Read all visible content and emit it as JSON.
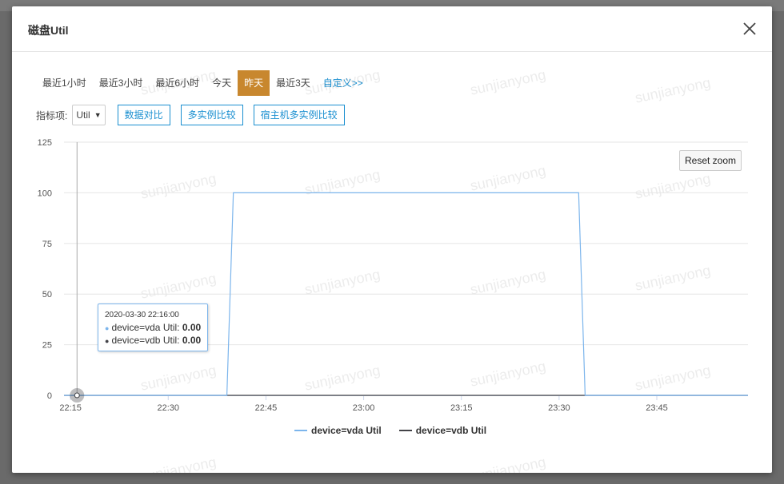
{
  "modal": {
    "title": "磁盘Util"
  },
  "time_ranges": [
    {
      "label": "最近1小时",
      "active": false
    },
    {
      "label": "最近3小时",
      "active": false
    },
    {
      "label": "最近6小时",
      "active": false
    },
    {
      "label": "今天",
      "active": false
    },
    {
      "label": "昨天",
      "active": true
    },
    {
      "label": "最近3天",
      "active": false
    }
  ],
  "custom_range_label": "自定义>>",
  "metric": {
    "label": "指标项:",
    "selected": "Util",
    "buttons": [
      "数据对比",
      "多实例比较",
      "宿主机多实例比较"
    ]
  },
  "reset_zoom_label": "Reset zoom",
  "watermark_text": "sunjianyong",
  "tooltip": {
    "time": "2020-03-30 22:16:00",
    "rows": [
      {
        "name": "device=vda Util",
        "value": "0.00",
        "color": "#7cb5ec"
      },
      {
        "name": "device=vdb Util",
        "value": "0.00",
        "color": "#434348"
      }
    ]
  },
  "chart_data": {
    "type": "line",
    "x_tick_labels": [
      "22:15",
      "22:30",
      "22:45",
      "23:00",
      "23:15",
      "23:30",
      "23:45"
    ],
    "y_tick_labels": [
      "0",
      "25",
      "50",
      "75",
      "100",
      "125"
    ],
    "ylim": [
      0,
      125
    ],
    "xlim": [
      "22:14",
      "23:59"
    ],
    "grid": true,
    "legend_position": "bottom-center",
    "series": [
      {
        "name": "device=vda Util",
        "color": "#7cb5ec",
        "points": [
          [
            "22:14",
            0
          ],
          [
            "22:39",
            0
          ],
          [
            "22:40",
            100
          ],
          [
            "23:33",
            100
          ],
          [
            "23:34",
            0
          ],
          [
            "23:59",
            0
          ]
        ]
      },
      {
        "name": "device=vdb Util",
        "color": "#434348",
        "points": [
          [
            "22:14",
            0
          ],
          [
            "23:59",
            0
          ]
        ]
      }
    ],
    "crosshair_x": "22:16"
  }
}
